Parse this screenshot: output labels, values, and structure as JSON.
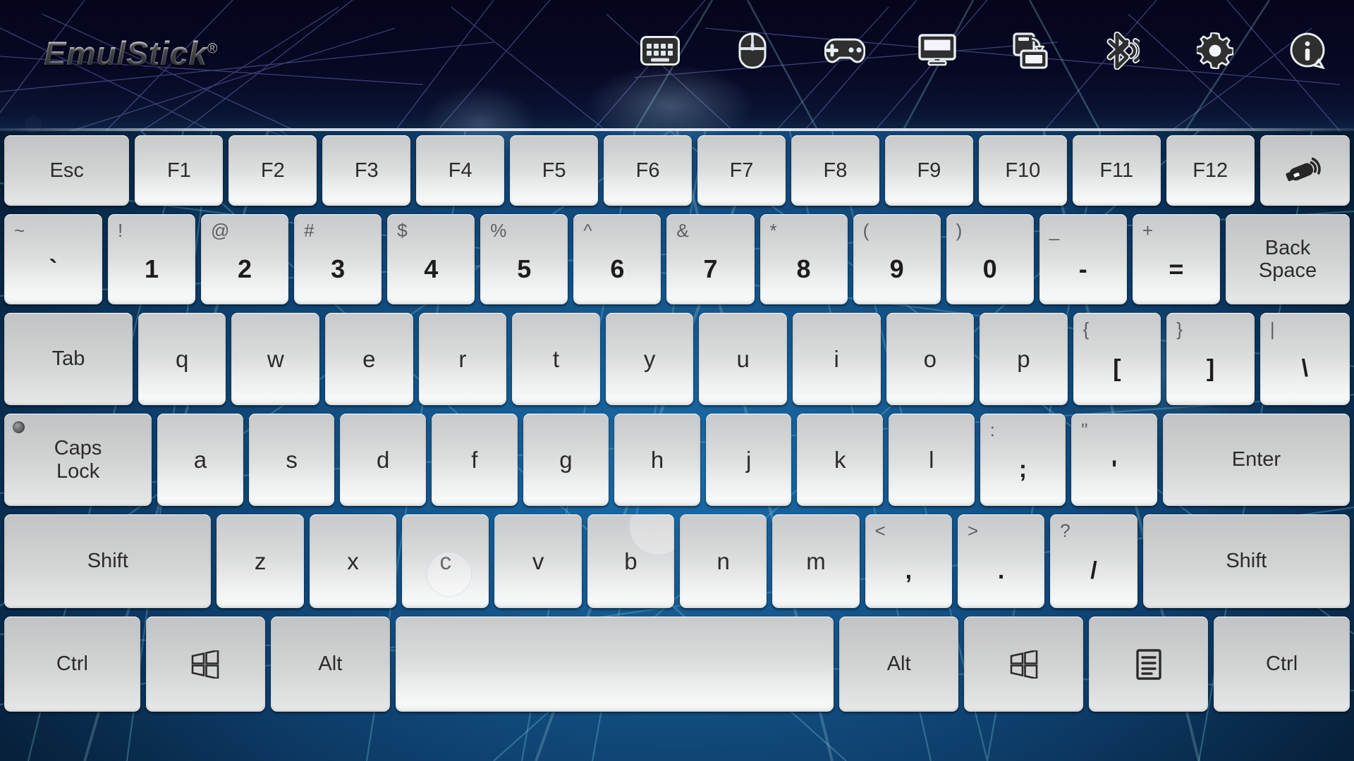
{
  "app": {
    "name": "EmulStick",
    "trademark": "®"
  },
  "colors": {
    "bg_dark": "#05061a",
    "bg_blue": "#14609b",
    "key_face": "#dcdddd",
    "key_text": "#2b2b2b",
    "icon_dark": "#2e2e2e"
  },
  "toolbar": {
    "items": [
      {
        "name": "keyboard-icon",
        "label": "Keyboard"
      },
      {
        "name": "mouse-icon",
        "label": "Mouse"
      },
      {
        "name": "gamepad-icon",
        "label": "Gamepad"
      },
      {
        "name": "display-icon",
        "label": "Display"
      },
      {
        "name": "backup-icon",
        "label": "Backup / Restore"
      },
      {
        "name": "bluetooth-icon",
        "label": "Bluetooth"
      },
      {
        "name": "gear-icon",
        "label": "Settings"
      },
      {
        "name": "info-icon",
        "label": "Info"
      }
    ]
  },
  "keyboard": {
    "rows": [
      {
        "name": "function-row",
        "keys": [
          {
            "type": "label",
            "label": "Esc",
            "flex": 1.42,
            "mod": true
          },
          {
            "type": "label",
            "label": "F1",
            "flex": 1
          },
          {
            "type": "label",
            "label": "F2",
            "flex": 1
          },
          {
            "type": "label",
            "label": "F3",
            "flex": 1
          },
          {
            "type": "label",
            "label": "F4",
            "flex": 1
          },
          {
            "type": "label",
            "label": "F5",
            "flex": 1
          },
          {
            "type": "label",
            "label": "F6",
            "flex": 1
          },
          {
            "type": "label",
            "label": "F7",
            "flex": 1
          },
          {
            "type": "label",
            "label": "F8",
            "flex": 1
          },
          {
            "type": "label",
            "label": "F9",
            "flex": 1
          },
          {
            "type": "label",
            "label": "F10",
            "flex": 1
          },
          {
            "type": "label",
            "label": "F11",
            "flex": 1
          },
          {
            "type": "label",
            "label": "F12",
            "flex": 1
          },
          {
            "type": "icon",
            "icon": "usb-dongle-icon",
            "label": "EmulStick device",
            "flex": 1.02,
            "mod": true
          }
        ]
      },
      {
        "name": "number-row",
        "keys": [
          {
            "type": "dual",
            "shifted": "~",
            "base": "`",
            "flex": 1.12
          },
          {
            "type": "dual",
            "shifted": "!",
            "base": "1",
            "flex": 1
          },
          {
            "type": "dual",
            "shifted": "@",
            "base": "2",
            "flex": 1
          },
          {
            "type": "dual",
            "shifted": "#",
            "base": "3",
            "flex": 1
          },
          {
            "type": "dual",
            "shifted": "$",
            "base": "4",
            "flex": 1
          },
          {
            "type": "dual",
            "shifted": "%",
            "base": "5",
            "flex": 1
          },
          {
            "type": "dual",
            "shifted": "^",
            "base": "6",
            "flex": 1
          },
          {
            "type": "dual",
            "shifted": "&",
            "base": "7",
            "flex": 1
          },
          {
            "type": "dual",
            "shifted": "*",
            "base": "8",
            "flex": 1
          },
          {
            "type": "dual",
            "shifted": "(",
            "base": "9",
            "flex": 1
          },
          {
            "type": "dual",
            "shifted": ")",
            "base": "0",
            "flex": 1
          },
          {
            "type": "dual",
            "shifted": "_",
            "base": "-",
            "flex": 1
          },
          {
            "type": "dual",
            "shifted": "+",
            "base": "=",
            "flex": 1
          },
          {
            "type": "label",
            "label": "Back\nSpace",
            "flex": 1.42,
            "mod": true
          }
        ]
      },
      {
        "name": "top-letter-row",
        "keys": [
          {
            "type": "label",
            "label": "Tab",
            "flex": 1.46,
            "mod": true
          },
          {
            "type": "char",
            "base": "q",
            "flex": 1
          },
          {
            "type": "char",
            "base": "w",
            "flex": 1
          },
          {
            "type": "char",
            "base": "e",
            "flex": 1
          },
          {
            "type": "char",
            "base": "r",
            "flex": 1
          },
          {
            "type": "char",
            "base": "t",
            "flex": 1
          },
          {
            "type": "char",
            "base": "y",
            "flex": 1
          },
          {
            "type": "char",
            "base": "u",
            "flex": 1
          },
          {
            "type": "char",
            "base": "i",
            "flex": 1
          },
          {
            "type": "char",
            "base": "o",
            "flex": 1
          },
          {
            "type": "char",
            "base": "p",
            "flex": 1
          },
          {
            "type": "dual",
            "shifted": "{",
            "base": "[",
            "flex": 1
          },
          {
            "type": "dual",
            "shifted": "}",
            "base": "]",
            "flex": 1
          },
          {
            "type": "dual",
            "shifted": "|",
            "base": "\\",
            "flex": 1.02
          }
        ]
      },
      {
        "name": "home-row",
        "keys": [
          {
            "type": "label",
            "label": "Caps\nLock",
            "flex": 1.72,
            "mod": true,
            "led": true
          },
          {
            "type": "char",
            "base": "a",
            "flex": 1
          },
          {
            "type": "char",
            "base": "s",
            "flex": 1
          },
          {
            "type": "char",
            "base": "d",
            "flex": 1
          },
          {
            "type": "char",
            "base": "f",
            "flex": 1
          },
          {
            "type": "char",
            "base": "g",
            "flex": 1
          },
          {
            "type": "char",
            "base": "h",
            "flex": 1
          },
          {
            "type": "char",
            "base": "j",
            "flex": 1
          },
          {
            "type": "char",
            "base": "k",
            "flex": 1
          },
          {
            "type": "char",
            "base": "l",
            "flex": 1
          },
          {
            "type": "dual",
            "shifted": ":",
            "base": ";",
            "flex": 1
          },
          {
            "type": "dual",
            "shifted": "\"",
            "base": "'",
            "flex": 1
          },
          {
            "type": "label",
            "label": "Enter",
            "flex": 2.18,
            "mod": true
          }
        ]
      },
      {
        "name": "bottom-letter-row",
        "keys": [
          {
            "type": "label",
            "label": "Shift",
            "flex": 2.38,
            "mod": true
          },
          {
            "type": "char",
            "base": "z",
            "flex": 1
          },
          {
            "type": "char",
            "base": "x",
            "flex": 1
          },
          {
            "type": "char",
            "base": "c",
            "flex": 1,
            "ripple": "small"
          },
          {
            "type": "char",
            "base": "v",
            "flex": 1
          },
          {
            "type": "char",
            "base": "b",
            "flex": 1,
            "ripple": "large"
          },
          {
            "type": "char",
            "base": "n",
            "flex": 1
          },
          {
            "type": "char",
            "base": "m",
            "flex": 1
          },
          {
            "type": "dual",
            "shifted": "<",
            "base": ",",
            "flex": 1
          },
          {
            "type": "dual",
            "shifted": ">",
            "base": ".",
            "flex": 1
          },
          {
            "type": "dual",
            "shifted": "?",
            "base": "/",
            "flex": 1
          },
          {
            "type": "label",
            "label": "Shift",
            "flex": 2.38,
            "mod": true
          }
        ]
      },
      {
        "name": "modifier-row",
        "keys": [
          {
            "type": "label",
            "label": "Ctrl",
            "flex": 1.62,
            "mod": true
          },
          {
            "type": "icon",
            "icon": "windows-icon",
            "label": "Windows",
            "flex": 1.42,
            "mod": true
          },
          {
            "type": "label",
            "label": "Alt",
            "flex": 1.42,
            "mod": true
          },
          {
            "type": "label",
            "label": "",
            "flex": 5.22,
            "name": "space-bar"
          },
          {
            "type": "label",
            "label": "Alt",
            "flex": 1.42,
            "mod": true
          },
          {
            "type": "icon",
            "icon": "windows-icon",
            "label": "Windows",
            "flex": 1.42,
            "mod": true
          },
          {
            "type": "icon",
            "icon": "context-menu-icon",
            "label": "Menu",
            "flex": 1.42,
            "mod": true
          },
          {
            "type": "label",
            "label": "Ctrl",
            "flex": 1.62,
            "mod": true
          }
        ]
      }
    ]
  }
}
